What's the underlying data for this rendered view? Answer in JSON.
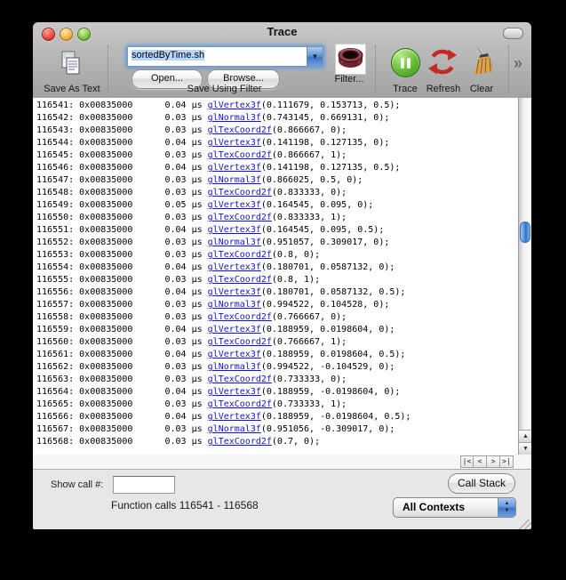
{
  "window": {
    "title": "Trace"
  },
  "toolbar": {
    "save_as_text_label": "Save As Text",
    "filename": "sortedByTime.sh",
    "open_label": "Open...",
    "browse_label": "Browse...",
    "group_label": "Save Using Filter",
    "filter_label": "Filter...",
    "trace_label": "Trace",
    "refresh_label": "Refresh",
    "clear_label": "Clear",
    "overflow_chevron": "»",
    "combo_arrow": "▼"
  },
  "trace_list": {
    "address": "0x00835000",
    "time_unit": "µs",
    "rows": [
      {
        "call": "116541",
        "time": "0.04",
        "fn": "glVertex3f",
        "args": "(0.111679, 0.153713, 0.5);"
      },
      {
        "call": "116542",
        "time": "0.03",
        "fn": "glNormal3f",
        "args": "(0.743145, 0.669131, 0);"
      },
      {
        "call": "116543",
        "time": "0.03",
        "fn": "glTexCoord2f",
        "args": "(0.866667, 0);"
      },
      {
        "call": "116544",
        "time": "0.04",
        "fn": "glVertex3f",
        "args": "(0.141198, 0.127135, 0);"
      },
      {
        "call": "116545",
        "time": "0.03",
        "fn": "glTexCoord2f",
        "args": "(0.866667, 1);"
      },
      {
        "call": "116546",
        "time": "0.04",
        "fn": "glVertex3f",
        "args": "(0.141198, 0.127135, 0.5);"
      },
      {
        "call": "116547",
        "time": "0.03",
        "fn": "glNormal3f",
        "args": "(0.866025, 0.5, 0);"
      },
      {
        "call": "116548",
        "time": "0.03",
        "fn": "glTexCoord2f",
        "args": "(0.833333, 0);"
      },
      {
        "call": "116549",
        "time": "0.05",
        "fn": "glVertex3f",
        "args": "(0.164545, 0.095, 0);"
      },
      {
        "call": "116550",
        "time": "0.03",
        "fn": "glTexCoord2f",
        "args": "(0.833333, 1);"
      },
      {
        "call": "116551",
        "time": "0.04",
        "fn": "glVertex3f",
        "args": "(0.164545, 0.095, 0.5);"
      },
      {
        "call": "116552",
        "time": "0.03",
        "fn": "glNormal3f",
        "args": "(0.951057, 0.309017, 0);"
      },
      {
        "call": "116553",
        "time": "0.03",
        "fn": "glTexCoord2f",
        "args": "(0.8, 0);"
      },
      {
        "call": "116554",
        "time": "0.04",
        "fn": "glVertex3f",
        "args": "(0.180701, 0.0587132, 0);"
      },
      {
        "call": "116555",
        "time": "0.03",
        "fn": "glTexCoord2f",
        "args": "(0.8, 1);"
      },
      {
        "call": "116556",
        "time": "0.04",
        "fn": "glVertex3f",
        "args": "(0.180701, 0.0587132, 0.5);"
      },
      {
        "call": "116557",
        "time": "0.03",
        "fn": "glNormal3f",
        "args": "(0.994522, 0.104528, 0);"
      },
      {
        "call": "116558",
        "time": "0.03",
        "fn": "glTexCoord2f",
        "args": "(0.766667, 0);"
      },
      {
        "call": "116559",
        "time": "0.04",
        "fn": "glVertex3f",
        "args": "(0.188959, 0.0198604, 0);"
      },
      {
        "call": "116560",
        "time": "0.03",
        "fn": "glTexCoord2f",
        "args": "(0.766667, 1);"
      },
      {
        "call": "116561",
        "time": "0.04",
        "fn": "glVertex3f",
        "args": "(0.188959, 0.0198604, 0.5);"
      },
      {
        "call": "116562",
        "time": "0.03",
        "fn": "glNormal3f",
        "args": "(0.994522, -0.104529, 0);"
      },
      {
        "call": "116563",
        "time": "0.03",
        "fn": "glTexCoord2f",
        "args": "(0.733333, 0);"
      },
      {
        "call": "116564",
        "time": "0.04",
        "fn": "glVertex3f",
        "args": "(0.188959, -0.0198604, 0);"
      },
      {
        "call": "116565",
        "time": "0.03",
        "fn": "glTexCoord2f",
        "args": "(0.733333, 1);"
      },
      {
        "call": "116566",
        "time": "0.04",
        "fn": "glVertex3f",
        "args": "(0.188959, -0.0198604, 0.5);"
      },
      {
        "call": "116567",
        "time": "0.03",
        "fn": "glNormal3f",
        "args": "(0.951056, -0.309017, 0);"
      },
      {
        "call": "116568",
        "time": "0.03",
        "fn": "glTexCoord2f",
        "args": "(0.7, 0);"
      }
    ]
  },
  "pager": {
    "first": "|<",
    "prev": "<",
    "next": ">",
    "last": ">|"
  },
  "scrollbar": {
    "up_arrow": "▲",
    "down_arrow": "▼"
  },
  "footer": {
    "show_call_label": "Show call #:",
    "show_call_value": "",
    "call_stack_label": "Call Stack",
    "range_text": "Function calls 116541 - 116568",
    "context_selected": "All Contexts"
  },
  "colors": {
    "link_blue": "#1414cc",
    "selection_blue": "#b5d5fa",
    "trace_green": "#63bb32",
    "refresh_red": "#c32a22",
    "filter_maroon": "#7d2b36",
    "toolbar_gray": "#b3b3b3",
    "footer_gray": "#e7e7e7"
  }
}
